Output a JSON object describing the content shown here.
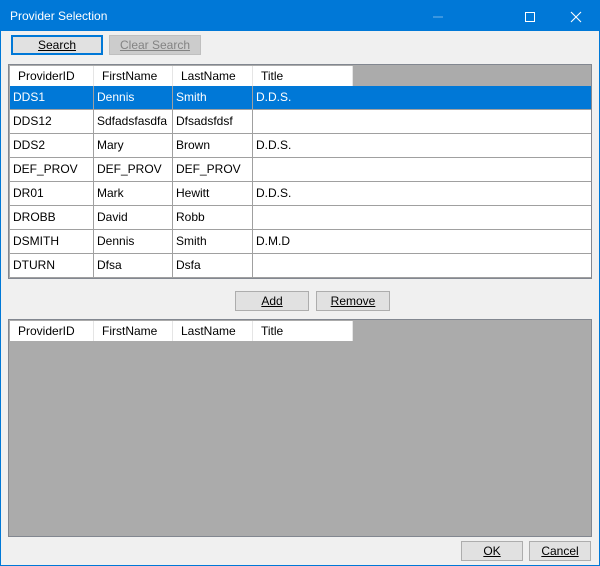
{
  "window": {
    "title": "Provider Selection"
  },
  "toolbar": {
    "search_label": "Search",
    "clear_search_label": "Clear Search"
  },
  "columns": [
    "ProviderID",
    "FirstName",
    "LastName",
    "Title"
  ],
  "providers": [
    {
      "id": "DDS1",
      "first": "Dennis",
      "last": "Smith",
      "title": "D.D.S.",
      "selected": true
    },
    {
      "id": "DDS12",
      "first": "Sdfadsfasdfa",
      "last": "Dfsadsfdsf",
      "title": ""
    },
    {
      "id": "DDS2",
      "first": "Mary",
      "last": "Brown",
      "title": "D.D.S."
    },
    {
      "id": "DEF_PROV",
      "first": "DEF_PROV",
      "last": "DEF_PROV",
      "title": ""
    },
    {
      "id": "DR01",
      "first": "Mark",
      "last": "Hewitt",
      "title": "D.D.S."
    },
    {
      "id": "DROBB",
      "first": "David",
      "last": "Robb",
      "title": ""
    },
    {
      "id": "DSMITH",
      "first": "Dennis",
      "last": "Smith",
      "title": "D.M.D"
    },
    {
      "id": "DTURN",
      "first": "Dfsa",
      "last": "Dsfa",
      "title": ""
    }
  ],
  "actions": {
    "add_label": "Add",
    "remove_label": "Remove"
  },
  "selected_columns": [
    "ProviderID",
    "FirstName",
    "LastName",
    "Title"
  ],
  "footer": {
    "ok_label": "OK",
    "cancel_label": "Cancel"
  }
}
